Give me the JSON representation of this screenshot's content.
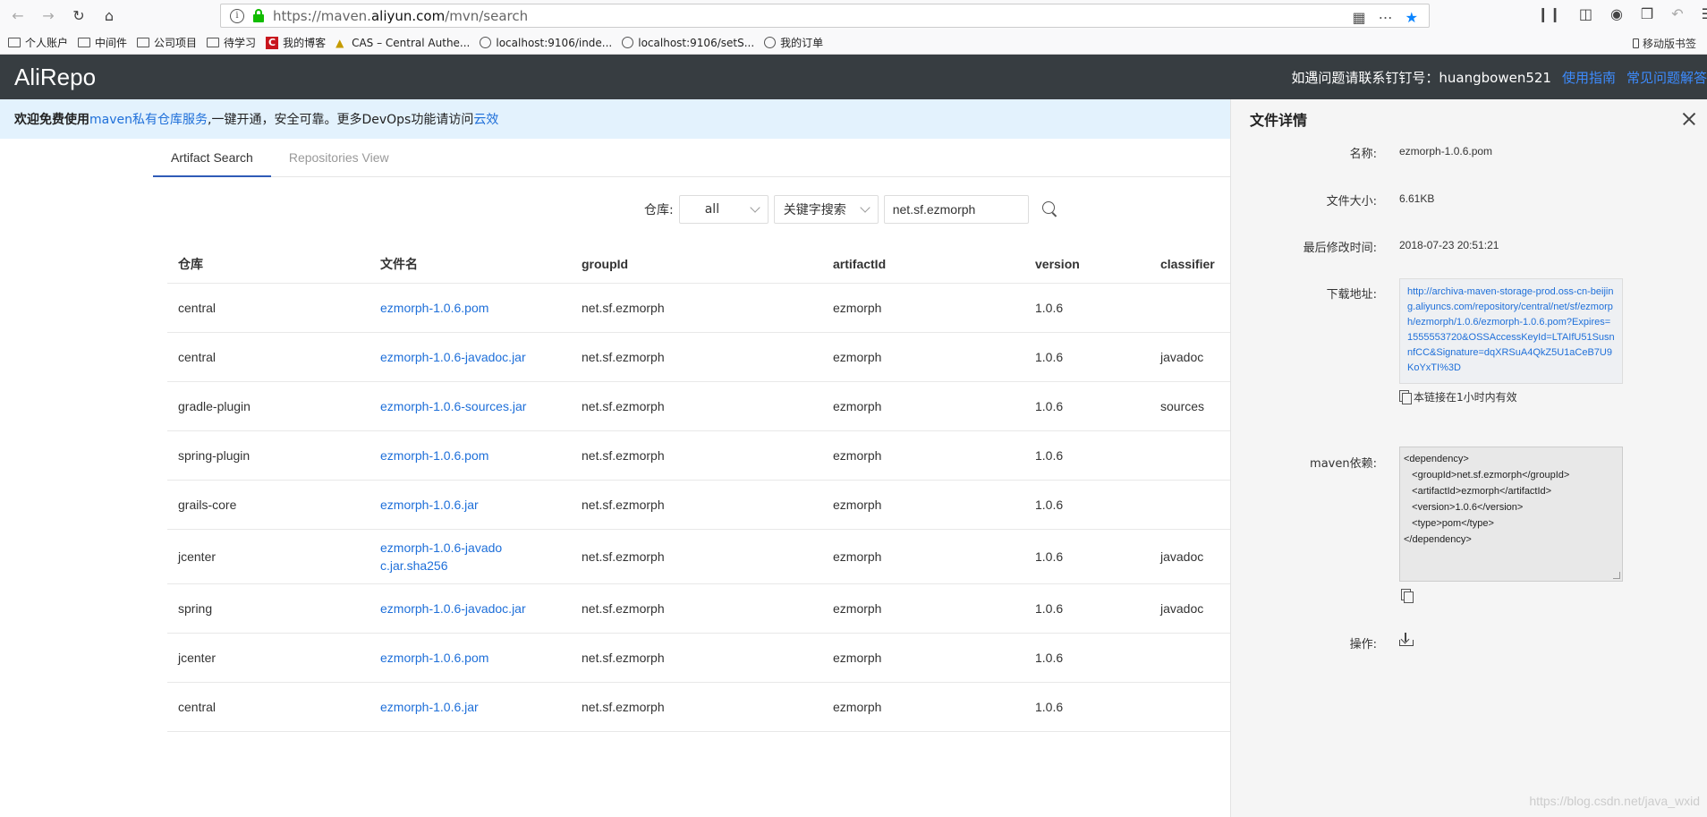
{
  "browser": {
    "url_prefix": "https://maven.",
    "url_domain": "aliyun.com",
    "url_path": "/mvn/search",
    "bookmarks": [
      {
        "label": "个人账户",
        "icon": "folder-icon"
      },
      {
        "label": "中间件",
        "icon": "folder-icon"
      },
      {
        "label": "公司项目",
        "icon": "folder-icon"
      },
      {
        "label": "待学习",
        "icon": "folder-icon"
      },
      {
        "label": "我的博客",
        "icon": "csdn-icon"
      },
      {
        "label": "CAS – Central Authe...",
        "icon": "cas-icon"
      },
      {
        "label": "localhost:9106/inde...",
        "icon": "globe-icon"
      },
      {
        "label": "localhost:9106/setS...",
        "icon": "globe-icon"
      },
      {
        "label": "我的订单",
        "icon": "globe-icon"
      }
    ],
    "mobile_bookmarks": "移动版书签"
  },
  "header": {
    "logo": "AliRepo",
    "contact": "如遇问题请联系钉钉号：huangbowen521",
    "guide_link": "使用指南",
    "faq_link": "常见问题解答"
  },
  "banner": {
    "prefix": "欢迎免费使用",
    "link1": "maven私有仓库服务",
    "middle": ",一键开通，安全可靠。更多DevOps功能请访问",
    "link2": "云效"
  },
  "tabs": [
    {
      "label": "Artifact Search"
    },
    {
      "label": "Repositories View"
    }
  ],
  "search": {
    "repo_label": "仓库:",
    "repo_value": "all",
    "mode_value": "关键字搜索",
    "query": "net.sf.ezmorph"
  },
  "table": {
    "headers": [
      "仓库",
      "文件名",
      "groupId",
      "artifactId",
      "version",
      "classifier"
    ],
    "rows": [
      [
        "central",
        "ezmorph-1.0.6.pom",
        "net.sf.ezmorph",
        "ezmorph",
        "1.0.6",
        ""
      ],
      [
        "central",
        "ezmorph-1.0.6-javadoc.jar",
        "net.sf.ezmorph",
        "ezmorph",
        "1.0.6",
        "javadoc"
      ],
      [
        "gradle-plugin",
        "ezmorph-1.0.6-sources.jar",
        "net.sf.ezmorph",
        "ezmorph",
        "1.0.6",
        "sources"
      ],
      [
        "spring-plugin",
        "ezmorph-1.0.6.pom",
        "net.sf.ezmorph",
        "ezmorph",
        "1.0.6",
        ""
      ],
      [
        "grails-core",
        "ezmorph-1.0.6.jar",
        "net.sf.ezmorph",
        "ezmorph",
        "1.0.6",
        ""
      ],
      [
        "jcenter",
        "ezmorph-1.0.6-javadoc.jar.sha256",
        "net.sf.ezmorph",
        "ezmorph",
        "1.0.6",
        "javadoc"
      ],
      [
        "spring",
        "ezmorph-1.0.6-javadoc.jar",
        "net.sf.ezmorph",
        "ezmorph",
        "1.0.6",
        "javadoc"
      ],
      [
        "jcenter",
        "ezmorph-1.0.6.pom",
        "net.sf.ezmorph",
        "ezmorph",
        "1.0.6",
        ""
      ],
      [
        "central",
        "ezmorph-1.0.6.jar",
        "net.sf.ezmorph",
        "ezmorph",
        "1.0.6",
        ""
      ]
    ]
  },
  "details": {
    "title": "文件详情",
    "name_label": "名称:",
    "name_value": "ezmorph-1.0.6.pom",
    "size_label": "文件大小:",
    "size_value": "6.61KB",
    "modified_label": "最后修改时间:",
    "modified_value": "2018-07-23 20:51:21",
    "download_label": "下载地址:",
    "download_url": "http://archiva-maven-storage-prod.oss-cn-beijing.aliyuncs.com/repository/central/net/sf/ezmorph/ezmorph/1.0.6/ezmorph-1.0.6.pom?Expires=1555553720&OSSAccessKeyId=LTAIfU51SusnnfCC&Signature=dqXRSuA4QkZ5U1aCeB7U9KoYxTI%3D",
    "valid_note": "本链接在1小时内有效",
    "maven_label": "maven依赖:",
    "maven_snippet": "<dependency>\n   <groupId>net.sf.ezmorph</groupId>\n   <artifactId>ezmorph</artifactId>\n   <version>1.0.6</version>\n   <type>pom</type>\n</dependency>",
    "action_label": "操作:"
  },
  "watermark": "https://blog.csdn.net/java_wxid"
}
